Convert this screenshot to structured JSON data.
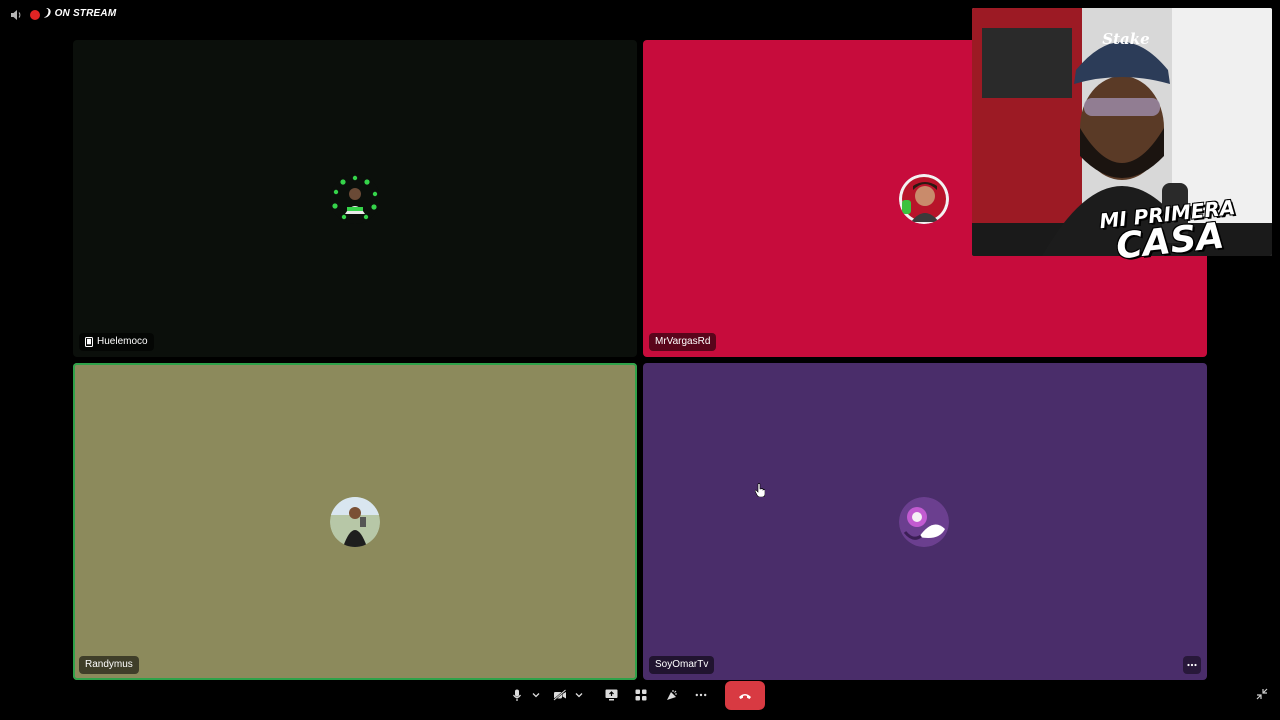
{
  "topbar": {
    "status_label": "ON STREAM",
    "speaker_icon": "speaker-icon",
    "live_color": "#e02424"
  },
  "participants": [
    {
      "name": "Huelemoco",
      "tile_color": "#0b0f0b",
      "device_icon": "mobile-icon"
    },
    {
      "name": "MrVargasRd",
      "tile_color": "#c70c3c"
    },
    {
      "name": "Randymus",
      "tile_color": "#8c8a5c",
      "speaking": true,
      "speaking_border": "#2fa24a"
    },
    {
      "name": "SoyOmarTv",
      "tile_color": "#4a2d6a"
    }
  ],
  "webcam_overlay": {
    "caption_line1": "MI PRIMERA",
    "caption_line2": "CASA",
    "cap_text": "Stake"
  },
  "controls": {
    "icons": [
      "microphone-icon",
      "chevron-down-icon",
      "camera-off-icon",
      "chevron-down-icon",
      "screen-share-icon",
      "activities-icon",
      "soundboard-icon",
      "more-icon",
      "hang-up-icon"
    ],
    "hangup_color": "#d83a42"
  }
}
